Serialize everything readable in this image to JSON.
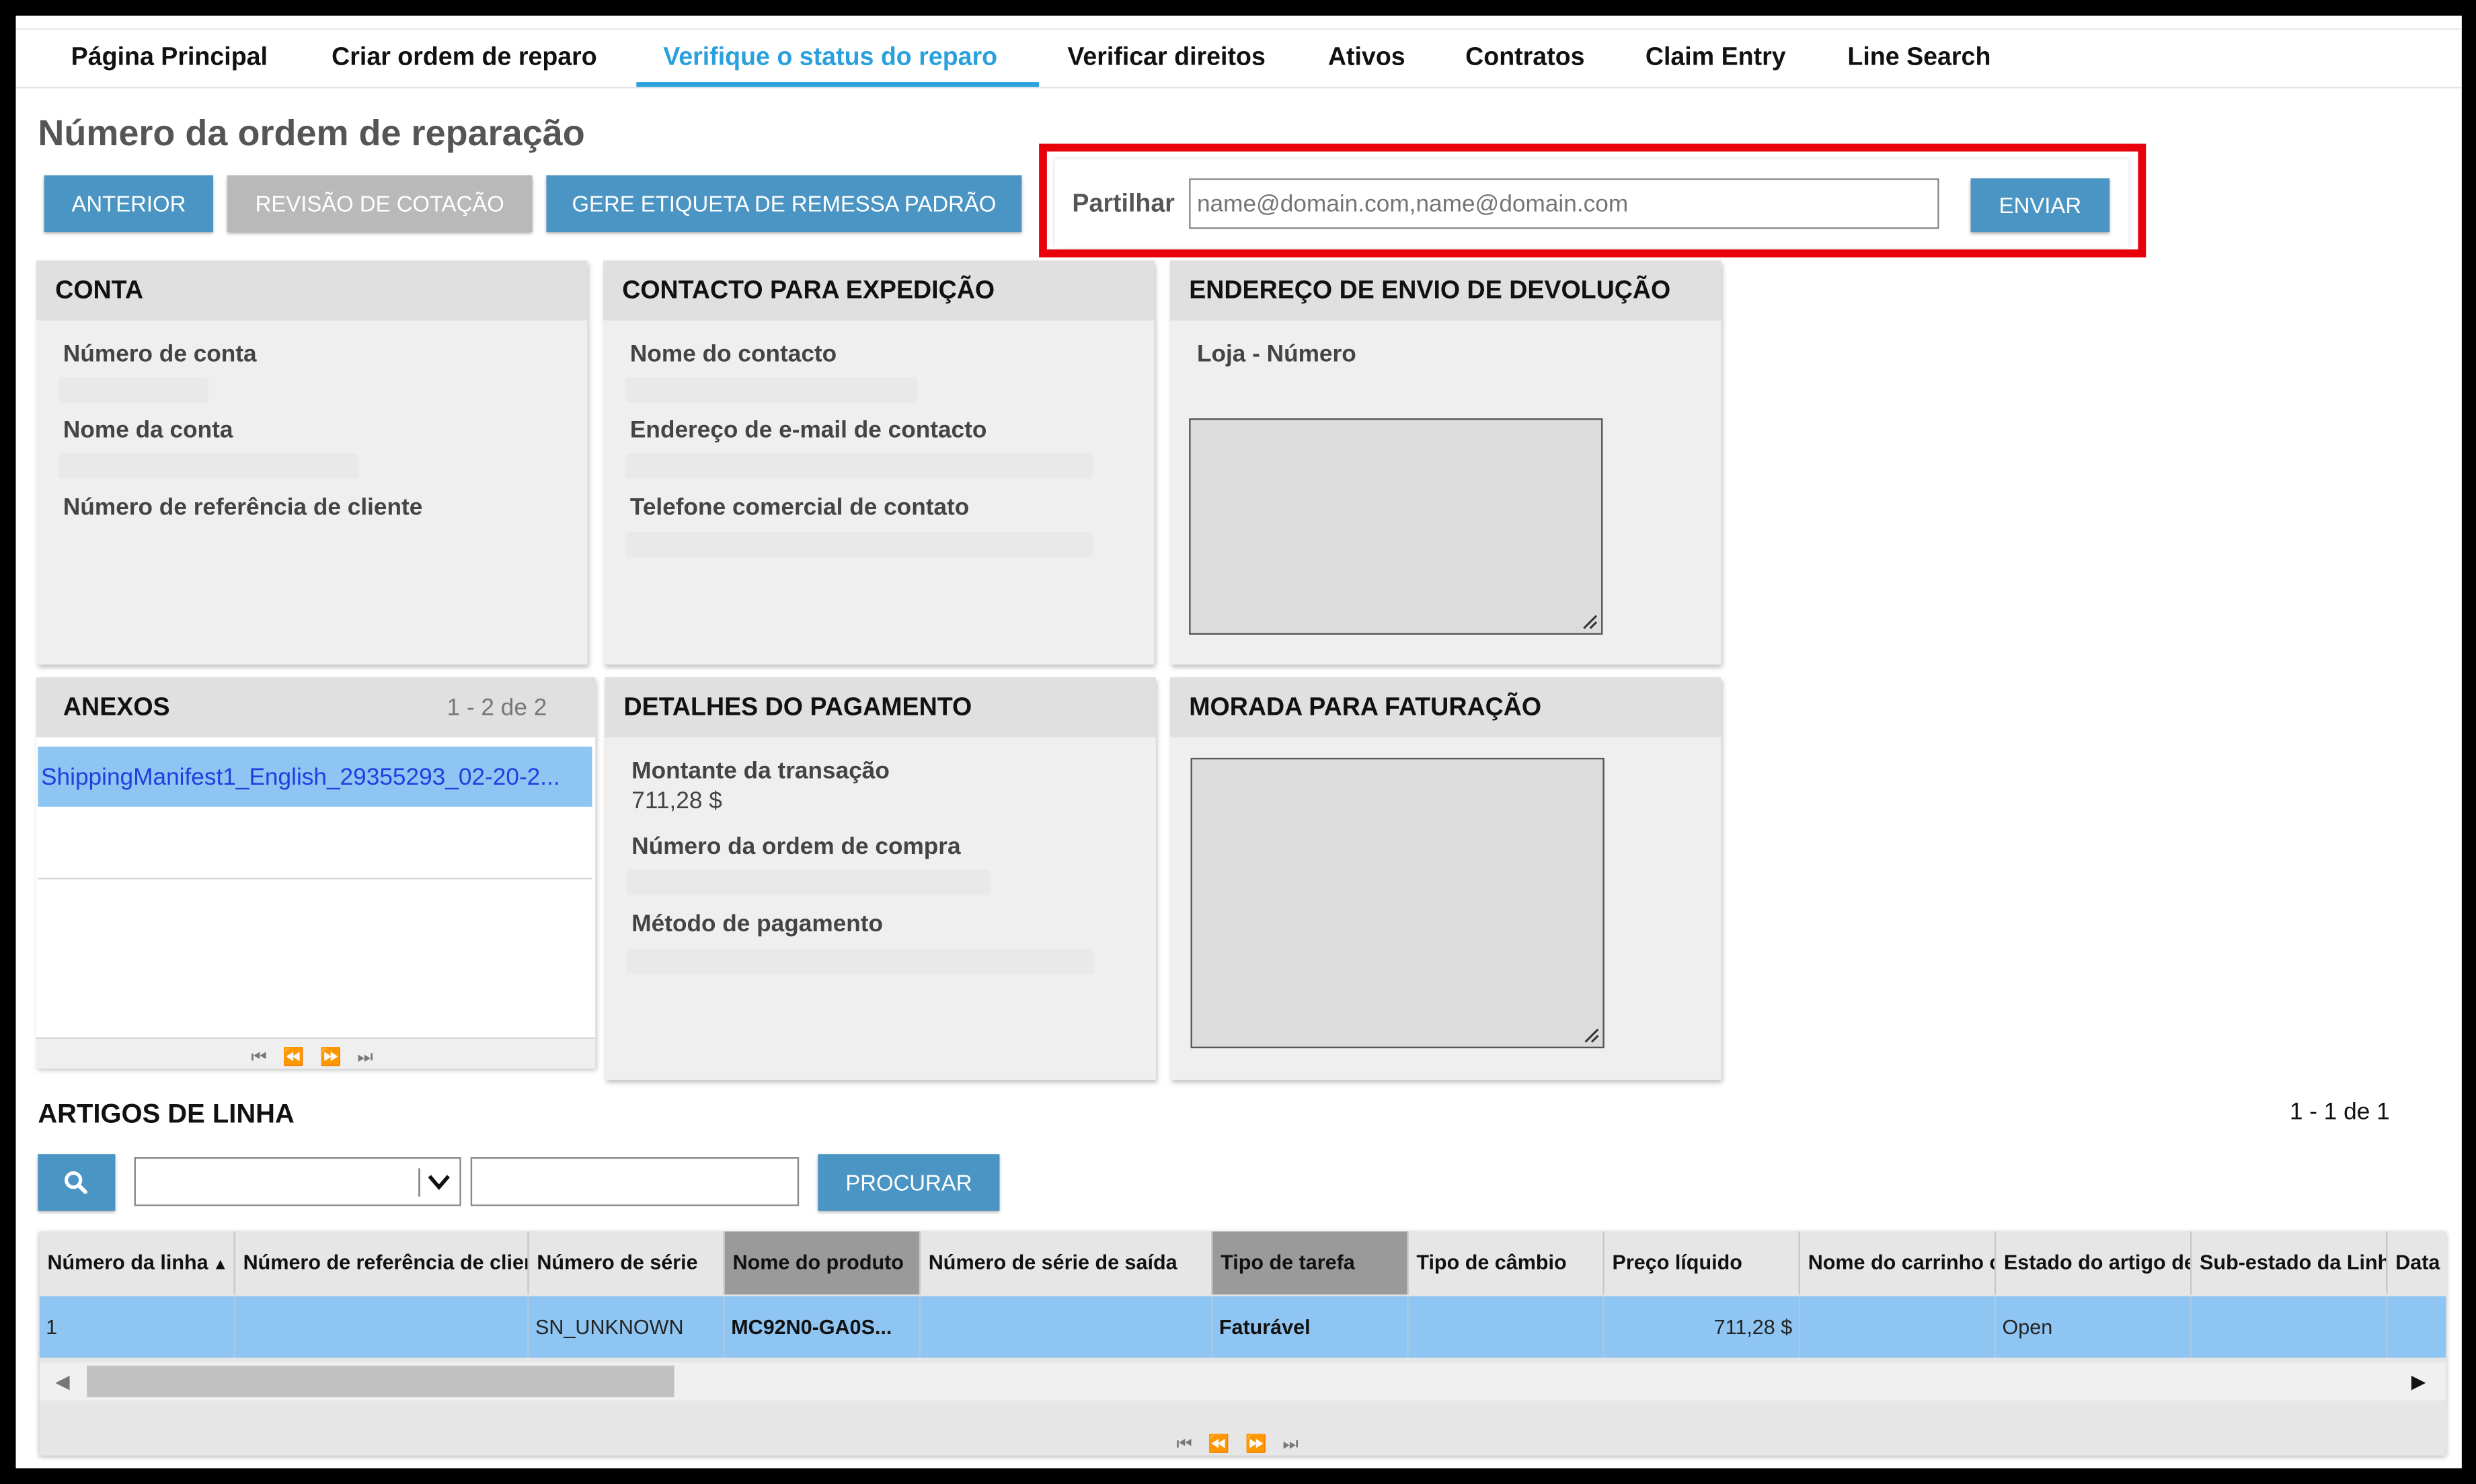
{
  "nav": {
    "items": [
      {
        "label": "Página Principal"
      },
      {
        "label": "Criar ordem de reparo"
      },
      {
        "label": "Verifique o status do reparo",
        "active": true
      },
      {
        "label": "Verificar direitos"
      },
      {
        "label": "Ativos"
      },
      {
        "label": "Contratos"
      },
      {
        "label": "Claim Entry"
      },
      {
        "label": "Line Search"
      }
    ]
  },
  "page": {
    "title": "Número da ordem de reparação"
  },
  "toolbar": {
    "anterior": "ANTERIOR",
    "revisao": "REVISÃO DE COTAÇÃO",
    "etiqueta": "GERE ETIQUETA DE REMESSA PADRÃO"
  },
  "share": {
    "label": "Partilhar",
    "placeholder": "name@domain.com,name@domain.com",
    "send": "ENVIAR"
  },
  "conta": {
    "title": "CONTA",
    "numero_conta": "Número de conta",
    "nome_conta": "Nome da conta",
    "referencia_cliente": "Número de referência de cliente"
  },
  "contacto": {
    "title": "CONTACTO PARA EXPEDIÇÃO",
    "nome": "Nome do contacto",
    "email": "Endereço de e-mail de contacto",
    "telefone": "Telefone comercial de contato"
  },
  "devolucao": {
    "title": "ENDEREÇO DE ENVIO DE DEVOLUÇÃO",
    "loja": "Loja - Número"
  },
  "anexos": {
    "title": "ANEXOS",
    "count": "1 - 2 de 2",
    "file": "ShippingManifest1_English_29355293_02-20-2..."
  },
  "pagamento": {
    "title": "DETALHES DO PAGAMENTO",
    "montante_label": "Montante da transação",
    "montante_value": "711,28 $",
    "ordem_compra": "Número da ordem de compra",
    "metodo": "Método de pagamento"
  },
  "faturacao": {
    "title": "MORADA PARA FATURAÇÃO"
  },
  "line_items": {
    "title": "ARTIGOS DE LINHA",
    "count": "1 - 1 de 1",
    "procurar": "PROCURAR",
    "columns": [
      "Número da linha",
      "Número de referência de clier",
      "Número de série",
      "Nome do produto",
      "Número de série de saída",
      "Tipo de tarefa",
      "Tipo de câmbio",
      "Preço líquido",
      "Nome do carrinho c",
      "Estado do artigo de",
      "Sub-estado da Linh",
      "Data"
    ],
    "row": [
      "1",
      "",
      "SN_UNKNOWN",
      "MC92N0-GA0S...",
      "",
      "Faturável",
      "",
      "711,28 $",
      "",
      "Open",
      "",
      ""
    ]
  },
  "colors": {
    "accent": "#2aa0dc",
    "button": "#4a95c4",
    "highlight": "#e8000b",
    "selection": "#8ec5f2"
  }
}
